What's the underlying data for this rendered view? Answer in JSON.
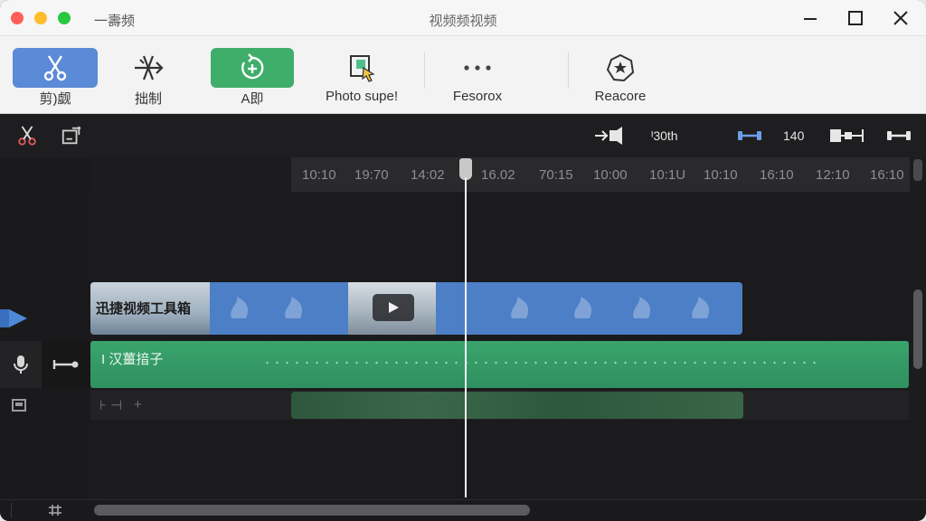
{
  "window": {
    "app_name": "一壽频",
    "title": "视频频视频"
  },
  "toolbar": {
    "items": [
      {
        "label": "剪)觑",
        "icon": "scissors-icon"
      },
      {
        "label": "拙制",
        "icon": "split-icon"
      },
      {
        "label": "A即",
        "icon": "add-rotate-icon"
      },
      {
        "label": "Photo supe!",
        "icon": "photo-cursor-icon"
      },
      {
        "label": "Fesorox",
        "icon": "more-dots-icon"
      },
      {
        "label": "Reacore",
        "icon": "badge-icon"
      }
    ]
  },
  "subbar": {
    "speed_label": "ᴵ30th",
    "zoom_value": "140"
  },
  "ruler": {
    "ticks": [
      "10:10",
      "19:70",
      "14:02",
      "16.02",
      "70:15",
      "10:00",
      "10:1U",
      "10:10",
      "16:10",
      "12:10",
      "16:10"
    ]
  },
  "tracks": {
    "video_clip_title": "迅捷视频工具箱",
    "audio_clip_title": "I 汉薑揞子",
    "fx_marks": [
      "⊦ ⊣",
      "+"
    ]
  },
  "colors": {
    "video_clip": "#4c7fc6",
    "audio_clip": "#3aa46c",
    "accent_blue": "#5b8ad6",
    "accent_green": "#3fae6a"
  }
}
